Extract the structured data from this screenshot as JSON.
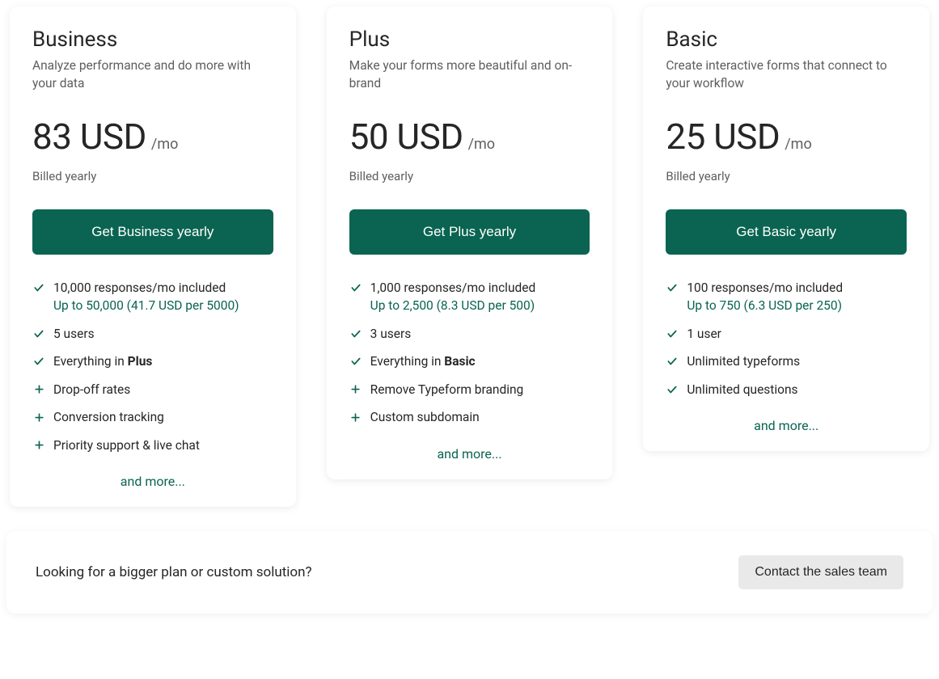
{
  "common": {
    "price_period": "/mo",
    "billed": "Billed yearly",
    "more": "and more..."
  },
  "plans": [
    {
      "name": "Business",
      "tagline": "Analyze performance and do more with your data",
      "price": "83 USD",
      "cta": "Get Business yearly",
      "features": [
        {
          "icon": "check",
          "text": "10,000 responses/mo included",
          "sub": "Up to 50,000 (41.7 USD per 5000)"
        },
        {
          "icon": "check",
          "text": "5 users"
        },
        {
          "icon": "check",
          "text_prefix": "Everything in ",
          "bold": "Plus"
        },
        {
          "icon": "plus",
          "text": "Drop-off rates"
        },
        {
          "icon": "plus",
          "text": "Conversion tracking"
        },
        {
          "icon": "plus",
          "text": "Priority support & live chat"
        }
      ]
    },
    {
      "name": "Plus",
      "tagline": "Make your forms more beautiful and on-brand",
      "price": "50 USD",
      "cta": "Get Plus yearly",
      "features": [
        {
          "icon": "check",
          "text": "1,000 responses/mo included",
          "sub": "Up to 2,500 (8.3 USD per 500)"
        },
        {
          "icon": "check",
          "text": "3 users"
        },
        {
          "icon": "check",
          "text_prefix": "Everything in ",
          "bold": "Basic"
        },
        {
          "icon": "plus",
          "text": "Remove Typeform branding"
        },
        {
          "icon": "plus",
          "text": "Custom subdomain"
        }
      ]
    },
    {
      "name": "Basic",
      "tagline": "Create interactive forms that connect to your workflow",
      "price": "25 USD",
      "cta": "Get Basic yearly",
      "features": [
        {
          "icon": "check",
          "text": "100 responses/mo included",
          "sub": "Up to 750 (6.3 USD per 250)"
        },
        {
          "icon": "check",
          "text": "1 user"
        },
        {
          "icon": "check",
          "text": "Unlimited typeforms"
        },
        {
          "icon": "check",
          "text": "Unlimited questions"
        }
      ]
    }
  ],
  "sales": {
    "prompt": "Looking for a bigger plan or custom solution?",
    "button": "Contact the sales team"
  }
}
